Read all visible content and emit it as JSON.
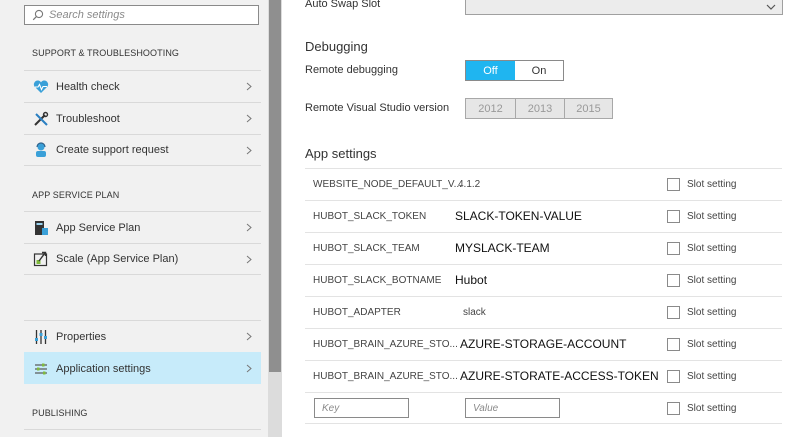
{
  "sidebar": {
    "search_placeholder": "Search settings",
    "sections": [
      {
        "title": "SUPPORT & TROUBLESHOOTING",
        "items": [
          {
            "label": "Health check",
            "icon": "heart-icon"
          },
          {
            "label": "Troubleshoot",
            "icon": "tools-icon"
          },
          {
            "label": "Create support request",
            "icon": "support-person-icon"
          }
        ]
      },
      {
        "title": "APP SERVICE PLAN",
        "items": [
          {
            "label": "App Service Plan",
            "icon": "app-service-plan-icon"
          },
          {
            "label": "Scale (App Service Plan)",
            "icon": "scale-icon"
          }
        ]
      },
      {
        "title": "",
        "items": [
          {
            "label": "Properties",
            "icon": "properties-icon"
          },
          {
            "label": "Application settings",
            "icon": "application-settings-icon",
            "selected": true
          }
        ]
      },
      {
        "title": "PUBLISHING",
        "items": []
      }
    ]
  },
  "settings": {
    "auto_swap_label": "Auto Swap Slot",
    "auto_swap_value": "",
    "debugging": {
      "heading": "Debugging",
      "remote_debugging_label": "Remote debugging",
      "remote_debugging_options": [
        "Off",
        "On"
      ],
      "remote_debugging_selected": "Off",
      "vs_version_label": "Remote Visual Studio version",
      "vs_version_options": [
        "2012",
        "2013",
        "2015"
      ]
    },
    "app_settings": {
      "heading": "App settings",
      "slot_setting_label": "Slot setting",
      "rows": [
        {
          "key": "WEBSITE_NODE_DEFAULT_V...",
          "value": "4.1.2",
          "value_style": "small"
        },
        {
          "key": "HUBOT_SLACK_TOKEN",
          "value": "SLACK-TOKEN-VALUE",
          "value_style": "big"
        },
        {
          "key": "HUBOT_SLACK_TEAM",
          "value": "MYSLACK-TEAM",
          "value_style": "big"
        },
        {
          "key": "HUBOT_SLACK_BOTNAME",
          "value": "Hubot",
          "value_style": "big"
        },
        {
          "key": "HUBOT_ADAPTER",
          "value": "slack",
          "value_style": "small"
        },
        {
          "key": "HUBOT_BRAIN_AZURE_STO...",
          "value": "AZURE-STORAGE-ACCOUNT",
          "value_style": "big"
        },
        {
          "key": "HUBOT_BRAIN_AZURE_STO...",
          "value": "AZURE-STORATE-ACCESS-TOKEN",
          "value_style": "big"
        }
      ],
      "new_key_placeholder": "Key",
      "new_value_placeholder": "Value"
    }
  },
  "colors": {
    "accent": "#1fb5f0",
    "selected_bg": "#c7ebfa",
    "sidebar_bg": "#f1f1f1",
    "scroll_thumb": "#8f8f8f"
  }
}
